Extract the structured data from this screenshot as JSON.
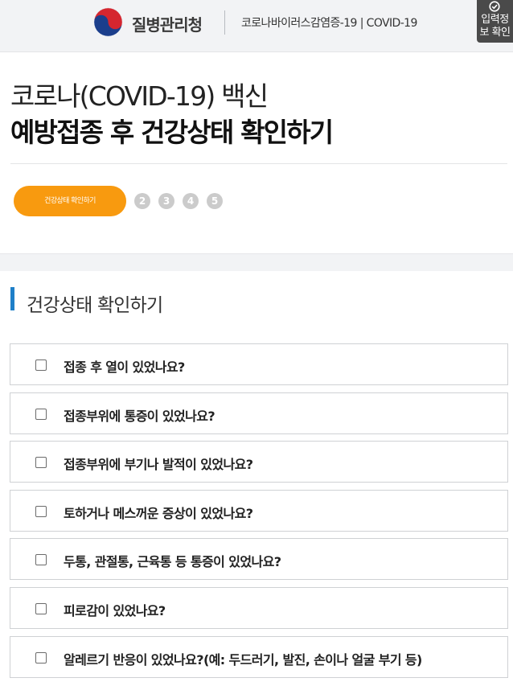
{
  "header": {
    "agency_name": "질병관리청",
    "subtitle": "코로나바이러스감염증-19 | COVID-19",
    "confirm_button_label": "입력정보 확인",
    "logo_icon": "taegeuk-logo-icon"
  },
  "title": {
    "line1": "코로나(COVID-19) 백신",
    "line2": "예방접종 후 건강상태 확인하기"
  },
  "steps": {
    "current_label": "건강상태 확인하기",
    "others": [
      "2",
      "3",
      "4",
      "5"
    ]
  },
  "section": {
    "title": "건강상태 확인하기"
  },
  "questions": [
    {
      "label": "접종 후 열이 있었나요?",
      "checked": false
    },
    {
      "label": "접종부위에 통증이 있었나요?",
      "checked": false
    },
    {
      "label": "접종부위에 부기나 발적이 있었나요?",
      "checked": false
    },
    {
      "label": "토하거나 메스꺼운 증상이 있었나요?",
      "checked": false
    },
    {
      "label": "두통, 관절통, 근육통 등 통증이 있었나요?",
      "checked": false
    },
    {
      "label": "피로감이 있었나요?",
      "checked": false
    },
    {
      "label": "알레르기 반응이 있었나요?(예: 두드러기, 발진, 손이나 얼굴 부기 등)",
      "checked": false
    }
  ],
  "colors": {
    "step_active": "#f89a0f",
    "step_inactive": "#cbcbcb",
    "section_accent": "#1e7fc8",
    "logo_red": "#d5262f",
    "logo_blue": "#1b3e8c"
  }
}
